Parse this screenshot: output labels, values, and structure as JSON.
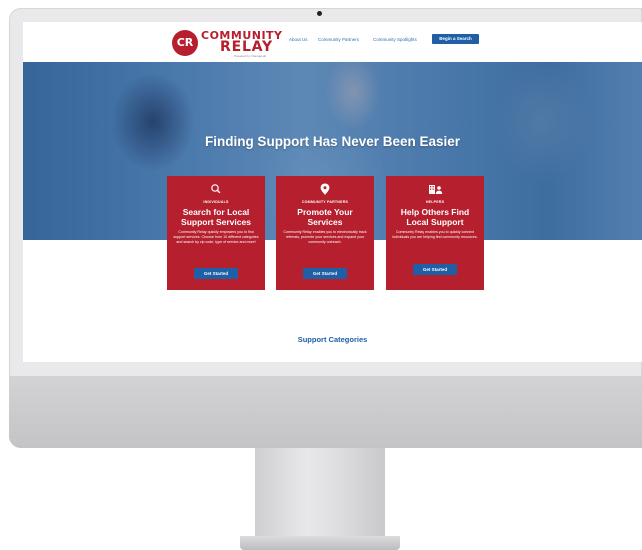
{
  "header": {
    "logo_word_1": "COMMUNITY",
    "logo_word_2": "RELAY",
    "logo_mark": "CR",
    "logo_tagline": "Powered by ChangeLab",
    "nav": [
      {
        "label": "About Us"
      },
      {
        "label": "Community Partners"
      },
      {
        "label": "Community Spotlights"
      }
    ],
    "search_button": "Begin a Search"
  },
  "hero": {
    "title": "Finding Support Has Never Been Easier"
  },
  "cards": [
    {
      "icon": "search-icon",
      "eyebrow": "INDIVIDUALS",
      "title": "Search for Local Support Services",
      "desc": "Community Relay quickly empowers you to find support services. Choose from 10 different categories and search by zip code, type of service and more!",
      "button": "Get Started"
    },
    {
      "icon": "location-pin-icon",
      "eyebrow": "COMMUNITY PARTNERS",
      "title": "Promote Your Services",
      "desc": "Community Relay enables you to electronically track referrals, promote your services and expand your community outreach.",
      "button": "Get Started"
    },
    {
      "icon": "helpers-icon",
      "eyebrow": "HELPERS",
      "title": "Help Others Find Local Support",
      "desc": "Community Relay enables you to quickly connect individuals you are helping find community resources.",
      "button": "Get Started"
    }
  ],
  "support_categories": {
    "heading": "Support Categories"
  },
  "colors": {
    "brand_red": "#b51f2e",
    "brand_blue": "#1f5fa6",
    "nav_link": "#2a6fb0"
  }
}
